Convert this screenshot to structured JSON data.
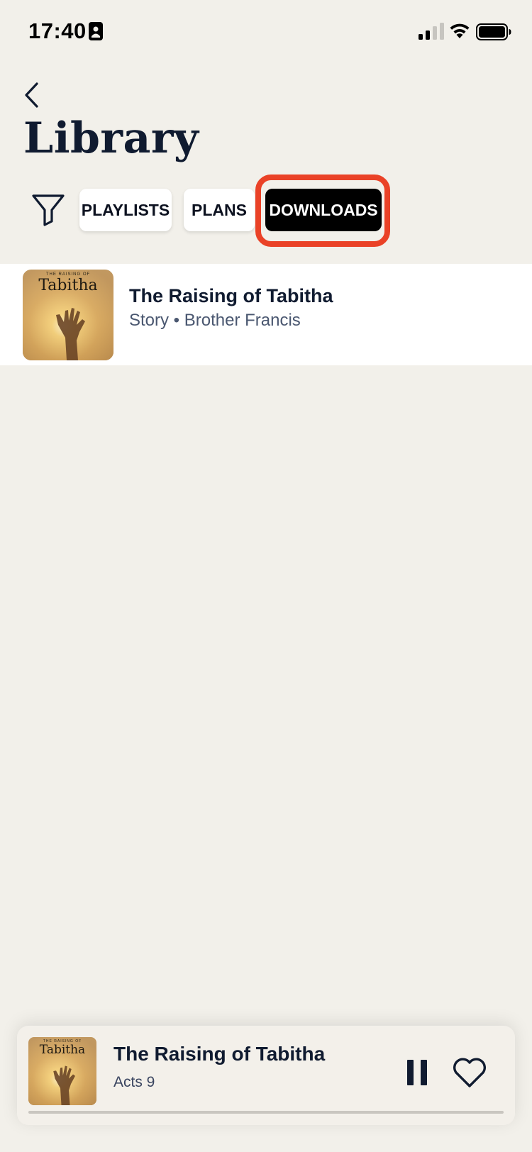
{
  "status_bar": {
    "time": "17:40",
    "icons": [
      "contact-card-icon",
      "cellular-signal-icon",
      "wifi-icon",
      "battery-icon"
    ]
  },
  "header": {
    "back_icon": "chevron-left-icon",
    "title": "Library"
  },
  "filters": {
    "filter_icon": "funnel-icon",
    "chips": [
      {
        "label": "PLAYLISTS",
        "selected": false
      },
      {
        "label": "PLANS",
        "selected": false
      },
      {
        "label": "DOWNLOADS",
        "selected": true
      }
    ],
    "highlight_color": "#ea4227"
  },
  "downloads": {
    "items": [
      {
        "title": "The Raising of Tabitha",
        "subtitle": "Story • Brother Francis",
        "artwork": {
          "caption": "THE RAISING OF",
          "title": "Tabitha"
        }
      }
    ]
  },
  "mini_player": {
    "title": "The Raising of Tabitha",
    "subtitle": "Acts 9",
    "artwork": {
      "caption": "THE RAISING OF",
      "title": "Tabitha"
    },
    "pause_icon": "pause-icon",
    "like_icon": "heart-outline-icon",
    "progress": 0.0
  },
  "colors": {
    "background": "#f2f0ea",
    "text_primary": "#101b30",
    "text_secondary": "#4a5770",
    "selected_chip": "#000000"
  }
}
